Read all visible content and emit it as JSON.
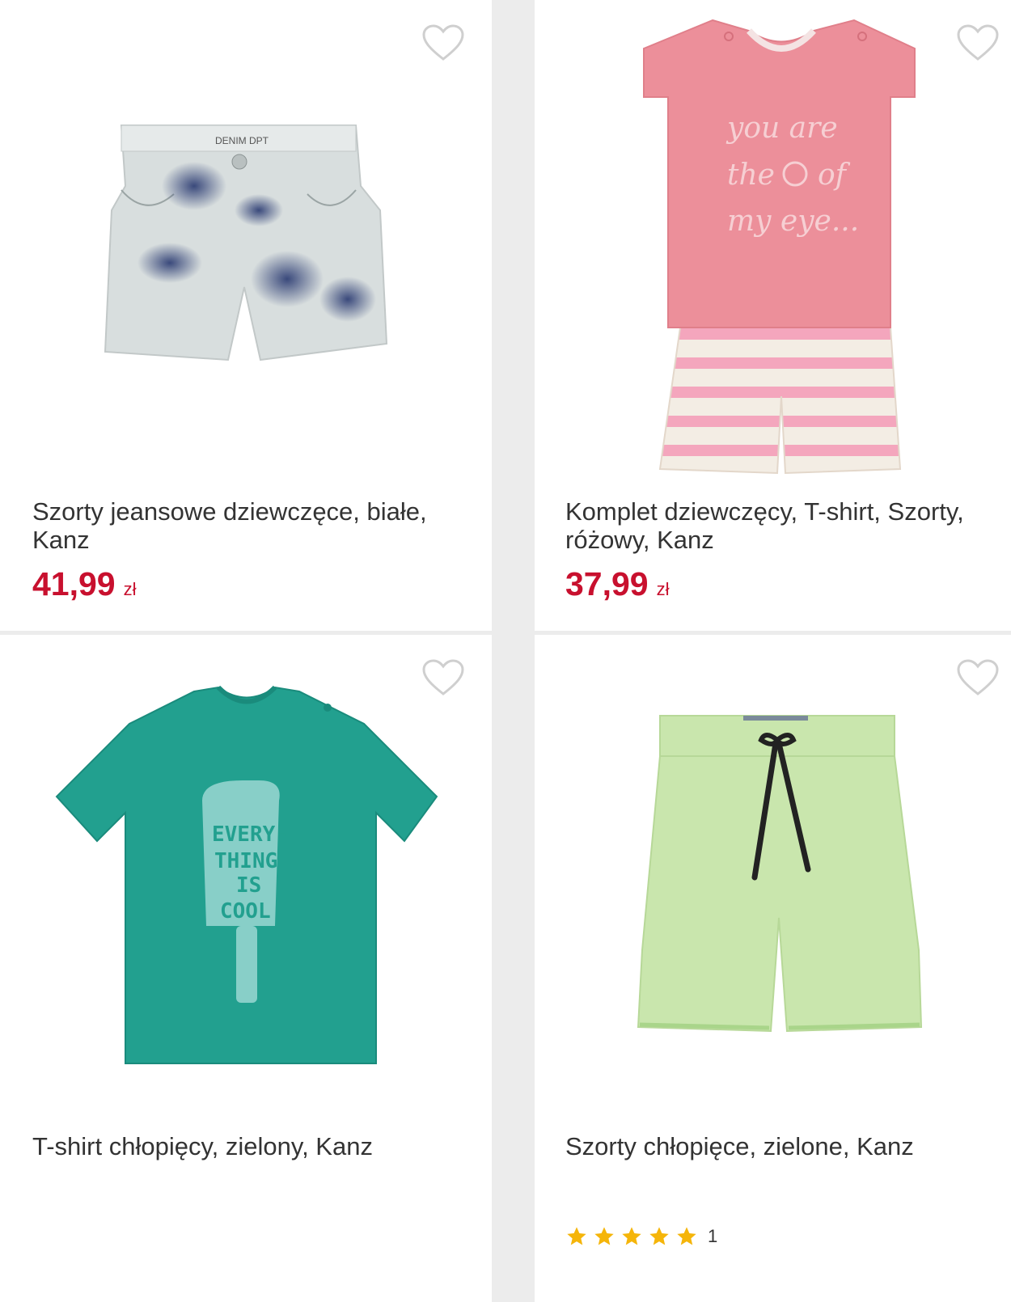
{
  "colors": {
    "price": "#c8102e",
    "heart": "#cfcfcf",
    "star": "#f5b50a",
    "background": "#ececec",
    "card": "#ffffff"
  },
  "products": [
    {
      "title": "Szorty jeansowe dziewczęce, białe, Kanz",
      "price": "41,99",
      "currency": "zł",
      "image": "tie-dye-denim-shorts",
      "image_text": "DENIM DPT",
      "favorite_icon": "heart-outline-icon"
    },
    {
      "title": "Komplet dziewczęcy, T-shirt, Szorty, różowy, Kanz",
      "price": "37,99",
      "currency": "zł",
      "image": "pink-tshirt-striped-shorts-set",
      "image_text": [
        "you are",
        "the",
        "of",
        "my eye..."
      ],
      "favorite_icon": "heart-outline-icon"
    },
    {
      "title": "T-shirt chłopięcy, zielony, Kanz",
      "image": "green-popsicle-tshirt",
      "image_text": [
        "EVERY-",
        "THING",
        "IS",
        "COOL"
      ],
      "favorite_icon": "heart-outline-icon"
    },
    {
      "title": "Szorty chłopięce, zielone, Kanz",
      "image": "mint-drawstring-shorts",
      "rating": {
        "stars": 5,
        "max": 5,
        "count": "1"
      },
      "favorite_icon": "heart-outline-icon"
    }
  ]
}
